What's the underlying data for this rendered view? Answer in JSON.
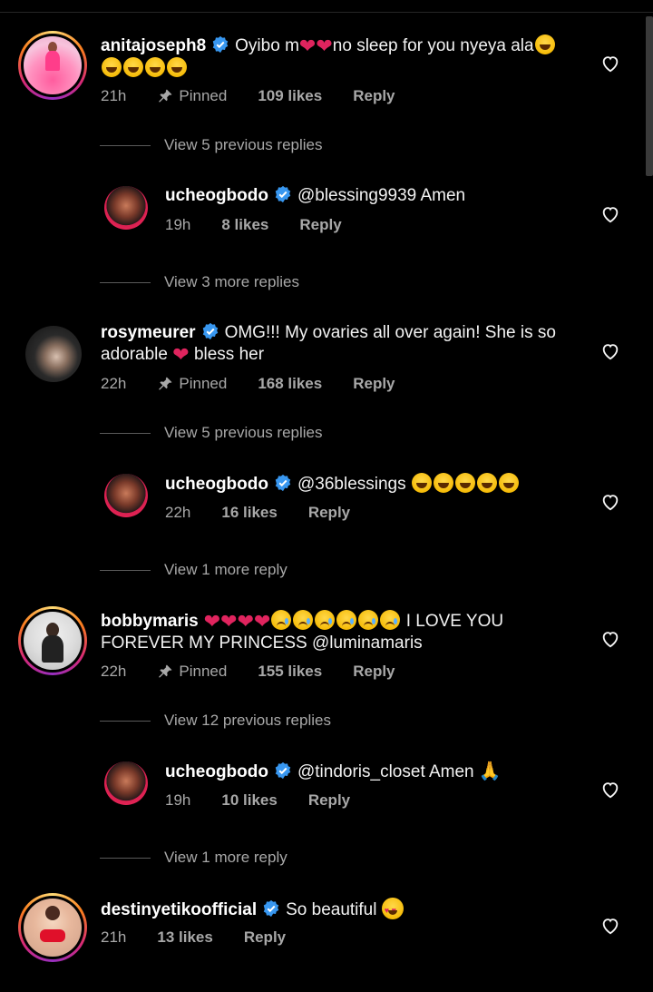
{
  "comments": [
    {
      "username": "anitajoseph8",
      "text_before": "Oyibo m",
      "text_after": "no sleep for you nyeya ala",
      "time": "21h",
      "pinned": "Pinned",
      "likes": "109 likes",
      "reply": "Reply",
      "view_replies": "View 5 previous replies"
    },
    {
      "username": "ucheogbodo",
      "text": "@blessing9939 Amen",
      "time": "19h",
      "likes": "8 likes",
      "reply": "Reply",
      "view_replies": "View 3 more replies"
    },
    {
      "username": "rosymeurer",
      "text_line1": "OMG!!! My ovaries all over again! She is so",
      "text_line2a": "adorable",
      "text_line2b": "bless her",
      "time": "22h",
      "pinned": "Pinned",
      "likes": "168 likes",
      "reply": "Reply",
      "view_replies": "View 5 previous replies"
    },
    {
      "username": "ucheogbodo",
      "text": "@36blessings",
      "time": "22h",
      "likes": "16 likes",
      "reply": "Reply",
      "view_replies": "View 1 more reply"
    },
    {
      "username": "bobbymaris",
      "text_after_emoji": "I LOVE YOU",
      "text_line2": "FOREVER MY PRINCESS @luminamaris",
      "time": "22h",
      "pinned": "Pinned",
      "likes": "155 likes",
      "reply": "Reply",
      "view_replies": "View 12 previous replies"
    },
    {
      "username": "ucheogbodo",
      "text": "@tindoris_closet Amen",
      "time": "19h",
      "likes": "10 likes",
      "reply": "Reply",
      "view_replies": "View 1 more reply"
    },
    {
      "username": "destinyetikoofficial",
      "text": "So beautiful",
      "time": "21h",
      "likes": "13 likes",
      "reply": "Reply"
    }
  ],
  "colors": {
    "background": "#000000",
    "verified": "#3897f0",
    "secondary_text": "#a8a8a8",
    "heart_emoji": "#e0245e"
  }
}
